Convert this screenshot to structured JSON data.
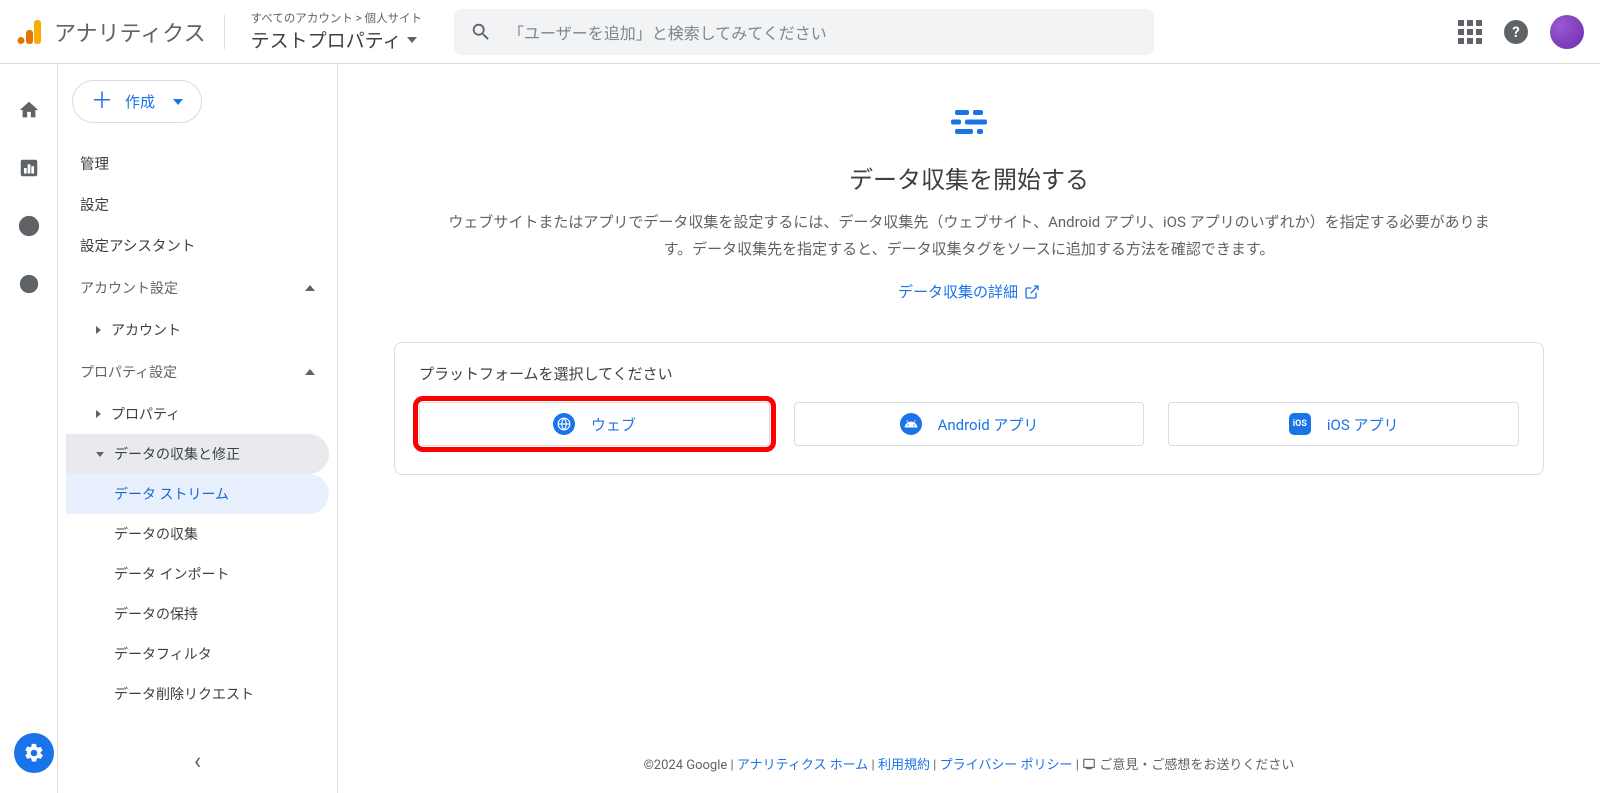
{
  "header": {
    "logo_text": "アナリティクス",
    "breadcrumb": "すべてのアカウント > 個人サイト",
    "property_name": "テストプロパティ",
    "search_placeholder": "「ユーザーを追加」と検索してみてください"
  },
  "sidebar": {
    "create_label": "作成",
    "items": [
      "管理",
      "設定",
      "設定アシスタント"
    ],
    "account_section": "アカウント設定",
    "account_sub": "アカウント",
    "property_section": "プロパティ設定",
    "property_sub": "プロパティ",
    "data_collection_sub": "データの収集と修正",
    "data_subs": [
      "データ ストリーム",
      "データの収集",
      "データ インポート",
      "データの保持",
      "データフィルタ",
      "データ削除リクエスト"
    ]
  },
  "hero": {
    "title": "データ収集を開始する",
    "text": "ウェブサイトまたはアプリでデータ収集を設定するには、データ収集先（ウェブサイト、Android アプリ、iOS アプリのいずれか）を指定する必要があります。データ収集先を指定すると、データ収集タグをソースに追加する方法を確認できます。",
    "link": "データ収集の詳細"
  },
  "card": {
    "title": "プラットフォームを選択してください",
    "platforms": [
      "ウェブ",
      "Android アプリ",
      "iOS アプリ"
    ]
  },
  "footer": {
    "copyright": "©2024 Google",
    "links": [
      "アナリティクス ホーム",
      "利用規約",
      "プライバシー ポリシー"
    ],
    "feedback": "ご意見・ご感想をお送りください"
  }
}
